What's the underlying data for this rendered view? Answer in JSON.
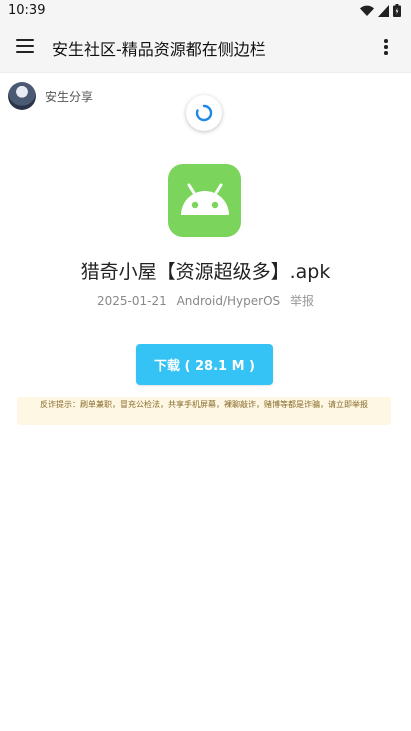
{
  "status_bar": {
    "time": "10:39"
  },
  "app_bar": {
    "title": "安生社区-精品资源都在侧边栏"
  },
  "author": {
    "name": "安生分享"
  },
  "file": {
    "name": "猎奇小屋【资源超级多】.apk",
    "date": "2025-01-21",
    "platform": "Android/HyperOS",
    "report_label": "举报"
  },
  "download": {
    "label": "下载 ( 28.1 M )"
  },
  "notice": {
    "text": "反诈提示：刷单兼职，冒充公检法，共享手机屏幕，裸聊敲诈，赌博等都是诈骗，请立即举报"
  },
  "colors": {
    "accent": "#35c3f5",
    "android_green": "#7bd45b",
    "notice_bg": "#fdf7e3"
  }
}
